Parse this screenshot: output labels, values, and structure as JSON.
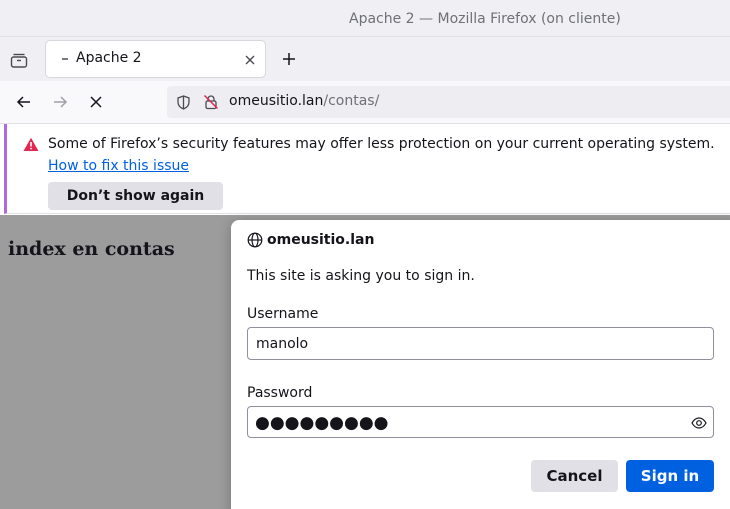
{
  "window": {
    "title": "Apache 2 — Mozilla Firefox (on cliente)"
  },
  "tabs": [
    {
      "label": "Apache 2",
      "favicon": "loading-dash-icon"
    }
  ],
  "toolbar": {
    "back_icon": "back-arrow-icon",
    "forward_icon": "forward-arrow-icon",
    "stop_icon": "stop-icon",
    "url_host": "omeusitio.lan",
    "url_path": "/contas/"
  },
  "notification": {
    "message": "Some of Firefox’s security features may offer less protection on your current operating system.",
    "link": "How to fix this issue",
    "dismiss_label": "Don’t show again"
  },
  "page": {
    "heading": "index en contas"
  },
  "auth_dialog": {
    "site": "omeusitio.lan",
    "prompt": "This site is asking you to sign in.",
    "username_label": "Username",
    "username_value": "manolo",
    "password_label": "Password",
    "password_mask": "●●●●●●●●●",
    "cancel_label": "Cancel",
    "signin_label": "Sign in"
  },
  "colors": {
    "accent": "#0061e0",
    "content_background": "#9c9c9c",
    "notification_bar": "#b06ae0",
    "warning": "#e22850"
  }
}
